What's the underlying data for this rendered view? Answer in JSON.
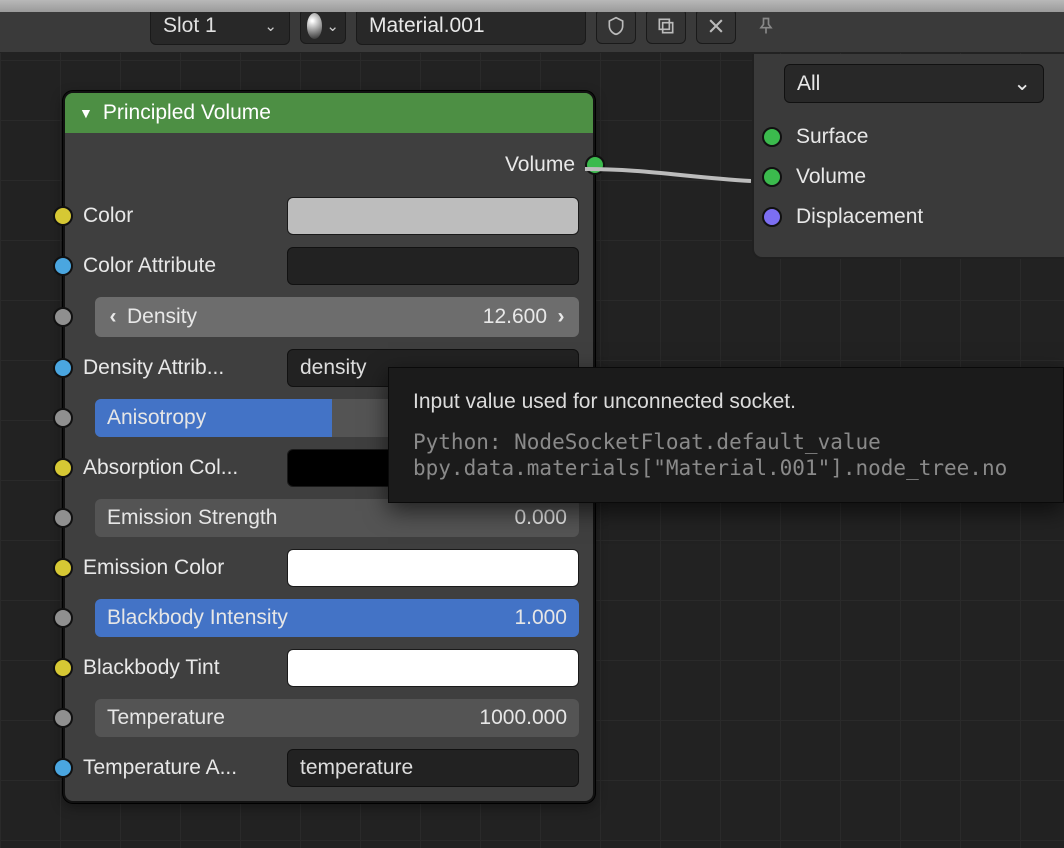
{
  "toolbar": {
    "slot_label": "Slot 1",
    "material_name": "Material.001"
  },
  "output_node": {
    "shader_filter": "All",
    "sockets": {
      "surface": "Surface",
      "volume": "Volume",
      "displacement": "Displacement"
    }
  },
  "node": {
    "title": "Principled Volume",
    "output_label": "Volume",
    "inputs": {
      "color": {
        "label": "Color",
        "swatch": "#bdbdbd"
      },
      "color_attribute": {
        "label": "Color Attribute",
        "value": ""
      },
      "density": {
        "label": "Density",
        "value": "12.600"
      },
      "density_attribute": {
        "label": "Density Attrib...",
        "value": "density"
      },
      "anisotropy": {
        "label": "Anisotropy",
        "value": "0.000"
      },
      "absorption_color": {
        "label": "Absorption Col...",
        "swatch": "#000000"
      },
      "emission_strength": {
        "label": "Emission Strength",
        "value": "0.000"
      },
      "emission_color": {
        "label": "Emission Color",
        "swatch": "#ffffff"
      },
      "blackbody_intensity": {
        "label": "Blackbody Intensity",
        "value": "1.000"
      },
      "blackbody_tint": {
        "label": "Blackbody Tint",
        "swatch": "#ffffff"
      },
      "temperature": {
        "label": "Temperature",
        "value": "1000.000"
      },
      "temperature_attribute": {
        "label": "Temperature A...",
        "value": "temperature"
      }
    }
  },
  "tooltip": {
    "desc": "Input value used for unconnected socket.",
    "py1": "Python: NodeSocketFloat.default_value",
    "py2": "bpy.data.materials[\"Material.001\"].node_tree.no"
  }
}
